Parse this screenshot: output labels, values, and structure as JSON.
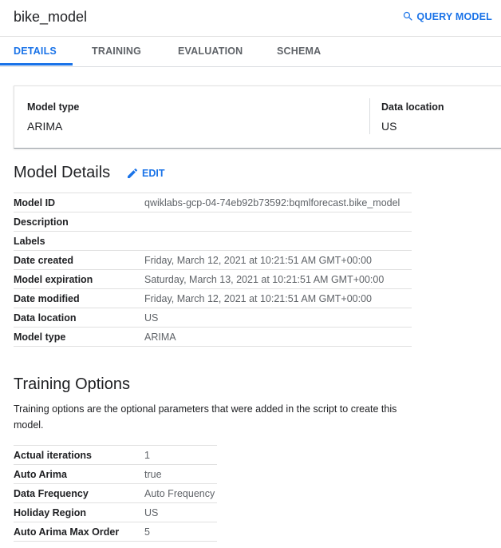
{
  "header": {
    "title": "bike_model",
    "query_label": "QUERY MODEL"
  },
  "tabs": [
    {
      "label": "DETAILS",
      "active": true
    },
    {
      "label": "TRAINING",
      "active": false
    },
    {
      "label": "EVALUATION",
      "active": false
    },
    {
      "label": "SCHEMA",
      "active": false
    }
  ],
  "summary": {
    "model_type_label": "Model type",
    "model_type_value": "ARIMA",
    "data_location_label": "Data location",
    "data_location_value": "US"
  },
  "model_details": {
    "title": "Model Details",
    "edit_label": "EDIT",
    "rows": [
      {
        "key": "Model ID",
        "value": "qwiklabs-gcp-04-74eb92b73592:bqmlforecast.bike_model"
      },
      {
        "key": "Description",
        "value": ""
      },
      {
        "key": "Labels",
        "value": ""
      },
      {
        "key": "Date created",
        "value": "Friday, March 12, 2021 at 10:21:51 AM GMT+00:00"
      },
      {
        "key": "Model expiration",
        "value": "Saturday, March 13, 2021 at 10:21:51 AM GMT+00:00"
      },
      {
        "key": "Date modified",
        "value": "Friday, March 12, 2021 at 10:21:51 AM GMT+00:00"
      },
      {
        "key": "Data location",
        "value": "US"
      },
      {
        "key": "Model type",
        "value": "ARIMA"
      }
    ]
  },
  "training_options": {
    "title": "Training Options",
    "description": "Training options are the optional parameters that were added in the script to create this model.",
    "rows": [
      {
        "key": "Actual iterations",
        "value": "1"
      },
      {
        "key": "Auto Arima",
        "value": "true"
      },
      {
        "key": "Data Frequency",
        "value": "Auto Frequency"
      },
      {
        "key": "Holiday Region",
        "value": "US"
      },
      {
        "key": "Auto Arima Max Order",
        "value": "5"
      }
    ]
  },
  "colors": {
    "accent": "#1a73e8",
    "text": "#202124",
    "secondary_text": "#5f6368",
    "divider": "#e0e0e0"
  }
}
